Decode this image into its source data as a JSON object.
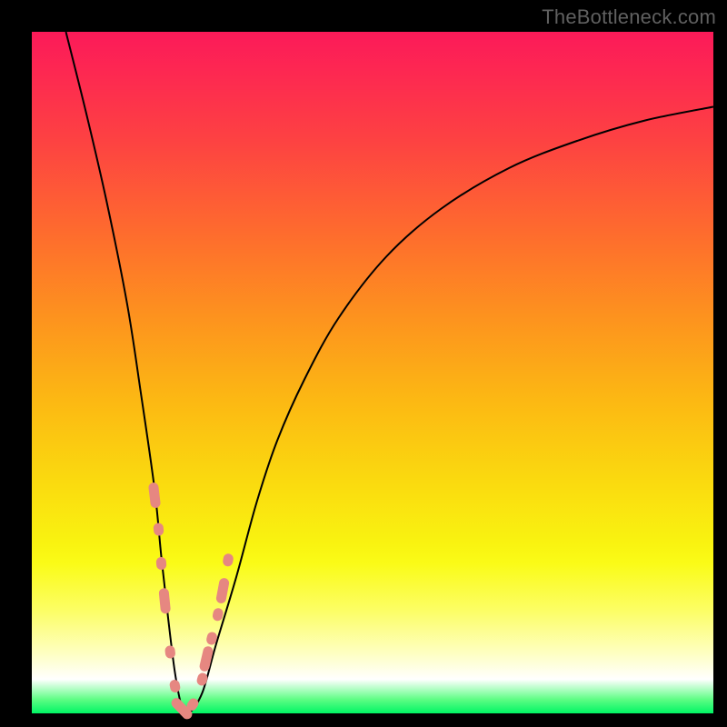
{
  "watermark": "TheBottleneck.com",
  "chart_data": {
    "type": "line",
    "title": "",
    "xlabel": "",
    "ylabel": "",
    "xlim": [
      0,
      100
    ],
    "ylim": [
      0,
      100
    ],
    "grid": false,
    "background_gradient": {
      "direction": "vertical",
      "stops": [
        {
          "pos": 0,
          "color": "#fc1a59"
        },
        {
          "pos": 16,
          "color": "#fd4242"
        },
        {
          "pos": 30,
          "color": "#fe6d2d"
        },
        {
          "pos": 42,
          "color": "#fd931e"
        },
        {
          "pos": 54,
          "color": "#fcb813"
        },
        {
          "pos": 66,
          "color": "#fada0f"
        },
        {
          "pos": 78,
          "color": "#fafb17"
        },
        {
          "pos": 91,
          "color": "#feffbf"
        },
        {
          "pos": 95,
          "color": "#ffffff"
        },
        {
          "pos": 100,
          "color": "#00f564"
        }
      ]
    },
    "series": [
      {
        "name": "bottleneck-curve",
        "color": "#000000",
        "x": [
          5,
          8,
          11,
          14,
          16,
          18,
          19,
          20,
          21,
          22,
          23,
          25,
          27,
          30,
          33,
          36,
          40,
          45,
          52,
          60,
          70,
          80,
          90,
          100
        ],
        "values": [
          100,
          88,
          75,
          60,
          47,
          33,
          23,
          14,
          6,
          1,
          0,
          3,
          10,
          20,
          31,
          40,
          49,
          58,
          67,
          74,
          80,
          84,
          87,
          89
        ]
      }
    ],
    "markers": {
      "name": "highlighted-points",
      "color": "#e68781",
      "shape": "capsule",
      "x": [
        18.0,
        18.6,
        19.0,
        19.5,
        20.3,
        21.0,
        22.0,
        23.6,
        25.0,
        25.6,
        26.4,
        27.3,
        28.0,
        28.8
      ],
      "values": [
        32.0,
        27.0,
        22.0,
        16.5,
        9.0,
        4.0,
        0.7,
        1.3,
        5.0,
        8.0,
        11.0,
        14.5,
        18.0,
        22.5
      ]
    },
    "minimum_at_x": 22.5
  }
}
